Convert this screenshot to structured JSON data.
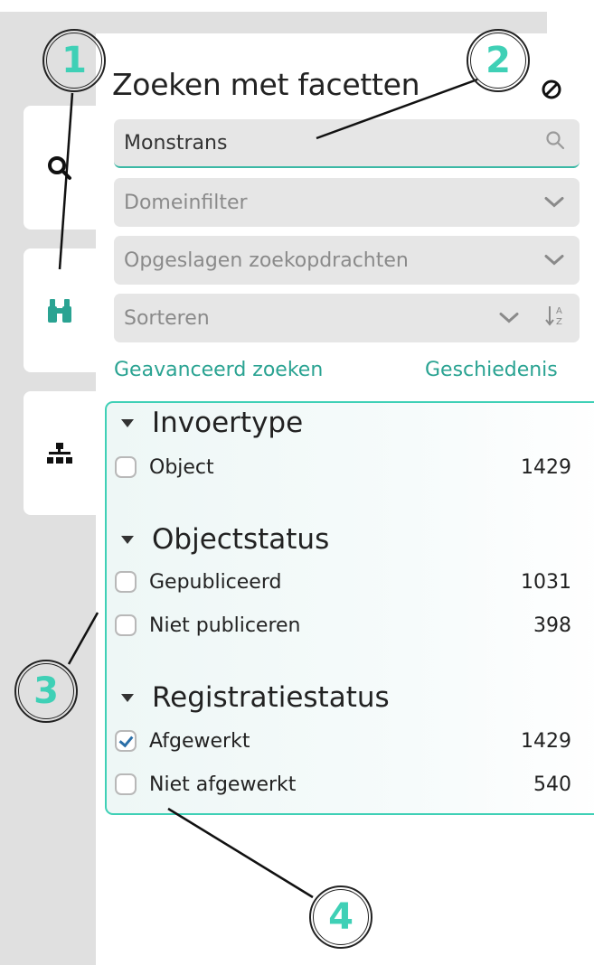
{
  "panel": {
    "title": "Zoeken met facetten",
    "clear_icon": "clear-filter-icon"
  },
  "sidebar": {
    "tabs": [
      {
        "name": "search",
        "icon": "search-icon"
      },
      {
        "name": "facets",
        "icon": "binoculars-icon",
        "active_color": "#2aa392"
      },
      {
        "name": "tree",
        "icon": "hierarchy-icon"
      }
    ]
  },
  "search": {
    "value": "Monstrans",
    "icon": "search-icon"
  },
  "filters": {
    "domain_label": "Domeinfilter",
    "saved_label": "Opgeslagen zoekopdrachten",
    "sort_label": "Sorteren",
    "sort_icon": "sort-alpha-icon"
  },
  "links": {
    "advanced": "Geavanceerd zoeken",
    "history": "Geschiedenis"
  },
  "facets": [
    {
      "title": "Invoertype",
      "items": [
        {
          "label": "Object",
          "count": "1429",
          "checked": false
        }
      ]
    },
    {
      "title": "Objectstatus",
      "items": [
        {
          "label": "Gepubliceerd",
          "count": "1031",
          "checked": false
        },
        {
          "label": "Niet publiceren",
          "count": "398",
          "checked": false
        }
      ]
    },
    {
      "title": "Registratiestatus",
      "items": [
        {
          "label": "Afgewerkt",
          "count": "1429",
          "checked": true
        },
        {
          "label": "Niet afgewerkt",
          "count": "540",
          "checked": false
        }
      ]
    }
  ],
  "callouts": [
    "1",
    "2",
    "3",
    "4"
  ],
  "colors": {
    "accent": "#3fd0b6",
    "link": "#2aa392",
    "sidebar_bg": "#e0e0e0",
    "field_bg": "#e6e6e6"
  }
}
